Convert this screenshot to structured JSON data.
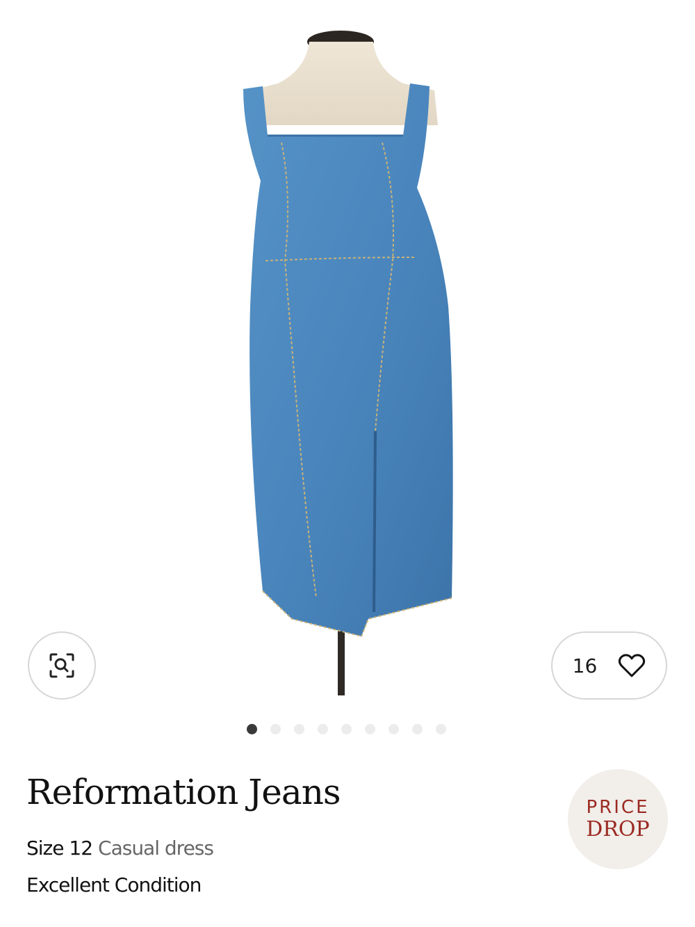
{
  "gallery": {
    "image_count": 9,
    "active_index": 0,
    "zoom_icon": "search-zoom-icon"
  },
  "favorites": {
    "count": "16",
    "icon": "heart-icon"
  },
  "product": {
    "brand": "Reformation Jeans",
    "size": "Size 12",
    "type": "Casual dress",
    "condition": "Excellent Condition"
  },
  "badge": {
    "line1": "PRICE",
    "line2": "DROP",
    "text_color": "#9b2a22",
    "bg_color": "#f2eeea"
  },
  "colors": {
    "denim": "#4a86bd",
    "denim_dark": "#3a6fa3"
  }
}
